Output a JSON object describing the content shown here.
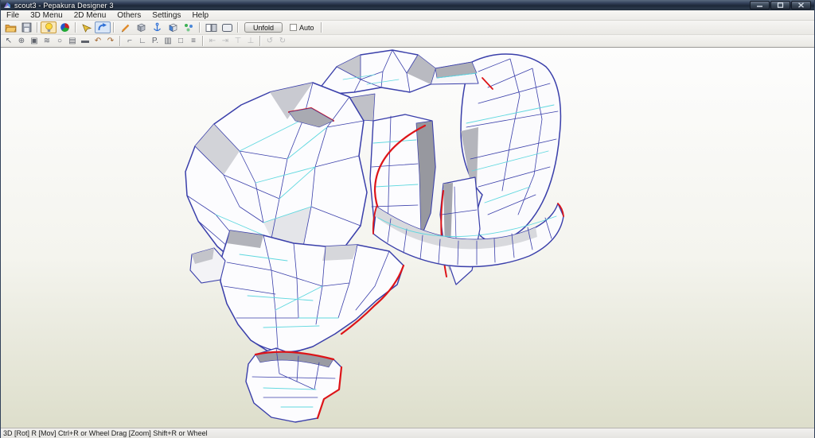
{
  "window": {
    "title": "scout3 - Pepakura Designer 3",
    "controls": [
      "minimize",
      "maximize",
      "close"
    ]
  },
  "menu_bar": {
    "items": [
      "File",
      "3D Menu",
      "2D Menu",
      "Others",
      "Settings",
      "Help"
    ]
  },
  "toolbar_main": {
    "unfold_label": "Unfold",
    "auto_label": "Auto",
    "auto_checked": false,
    "icons": [
      "open-folder",
      "save",
      "light-bulb (selected)",
      "material-ball",
      "select-3d",
      "rotate-view (selected)",
      "pencil",
      "solid-box",
      "anchor",
      "face-box",
      "vertex-dots",
      "split-view",
      "single-view"
    ]
  },
  "toolbar_edit": {
    "icons_enabled": [
      "cursor-select",
      "cursor-add",
      "image",
      "hatch-strokes",
      "cylinder",
      "notebook",
      "screen",
      "undo",
      "redo",
      "corner-edit",
      "edge-divide",
      "p-scale",
      "tape-measure",
      "box-select",
      "flatten"
    ],
    "icons_disabled": [
      "align-left",
      "align-right",
      "align-top",
      "align-bottom",
      "rotate-ccw",
      "rotate-cw"
    ],
    "glyphs": {
      "cursor-select": "↖",
      "cursor-add": "⊕",
      "image": "▣",
      "hatch-strokes": "≋",
      "cylinder": "○",
      "notebook": "▤",
      "screen": "▬",
      "undo": "↶",
      "redo": "↷",
      "corner-edit": "⌐",
      "edge-divide": "∟",
      "p-scale": "P.",
      "tape-measure": "▥",
      "box-select": "□",
      "flatten": "≡",
      "align-left": "⇤",
      "align-right": "⇥",
      "align-top": "⊤",
      "align-bottom": "⊥",
      "rotate-ccw": "↺",
      "rotate-cw": "↻"
    }
  },
  "viewport": {
    "content": "low-poly papercraft 3D mesh (scout helmet/headset parts) with detached chin piece",
    "background_top": "#fdfdfd",
    "background_bottom": "#dddecb",
    "edge_color": "#3a3faa",
    "fold_line_color": "#5fd8df",
    "open_edge_color": "#dd1418",
    "face_color": "#fcfcfe"
  },
  "status_bar": {
    "text": "3D [Rot] R [Mov] Ctrl+R or Wheel Drag [Zoom] Shift+R or Wheel"
  }
}
